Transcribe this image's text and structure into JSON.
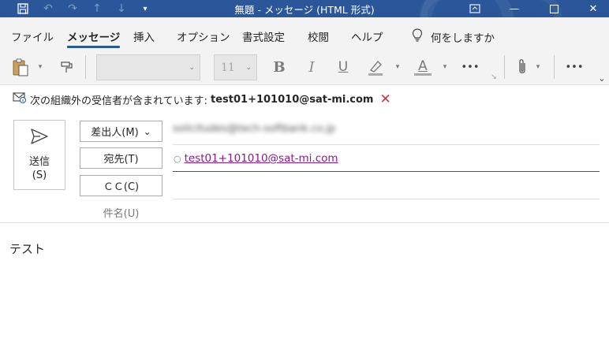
{
  "window": {
    "title": "無題 - メッセージ (HTML 形式)",
    "quick_access": [
      "save-icon",
      "undo-icon",
      "redo-icon",
      "up-arrow-icon",
      "down-arrow-icon",
      "customize-icon"
    ],
    "controls": [
      "restore-ribbon-icon",
      "minimize-icon",
      "maximize-icon",
      "close-icon"
    ]
  },
  "ribbon_tabs": [
    "ファイル",
    "メッセージ",
    "挿入",
    "オプション",
    "書式設定",
    "校閲",
    "ヘルプ"
  ],
  "active_tab": "メッセージ",
  "tell_me": "何をしますか",
  "toolbar": {
    "font_name": "",
    "font_size": "11",
    "bold": "B",
    "italic": "I",
    "underline": "U",
    "font_color_letter": "A",
    "more": "•••"
  },
  "notice": {
    "text": "次の組織外の受信者が含まれています:",
    "address": "test01+101010@sat-mi.com",
    "remove": "✕"
  },
  "send_button": {
    "line1": "送信",
    "line2": "(S)"
  },
  "fields": {
    "from_label": "差出人(M)",
    "from_value": "solicitudes@tech-softbank.co.jp",
    "to_label": "宛先(T)",
    "to_value": "test01+101010@sat-mi.com",
    "cc_label": "ＣＣ(C)",
    "subject_label": "件名(U)"
  },
  "body_text": "テスト",
  "colors": {
    "titlebar": "#2b579a",
    "ribbon": "#f3f3f3",
    "link": "#8c1a8c",
    "warning": "#d13438"
  }
}
